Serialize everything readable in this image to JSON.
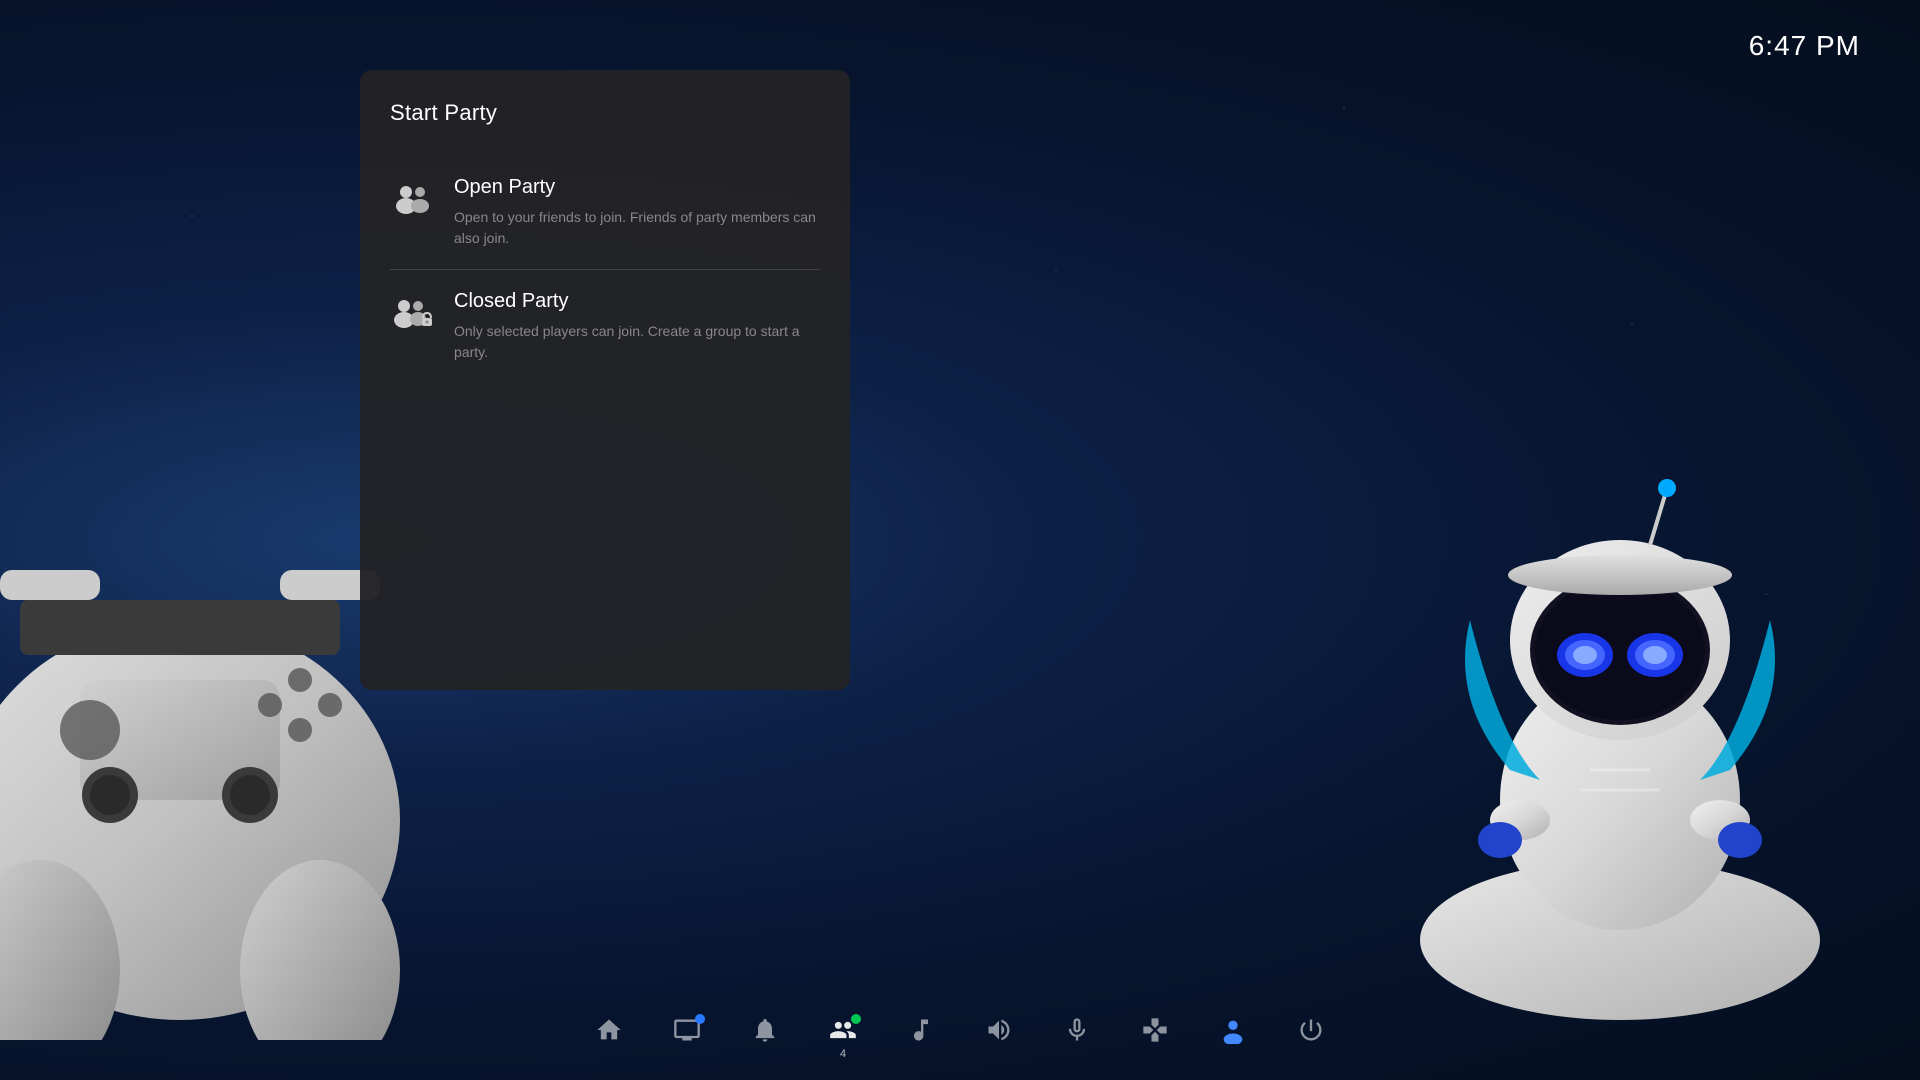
{
  "clock": {
    "time": "6:47 PM"
  },
  "panel": {
    "title": "Start Party",
    "items": [
      {
        "id": "open-party",
        "title": "Open Party",
        "description": "Open to your friends to join. Friends of party members can also join.",
        "icon": "open-party-icon"
      },
      {
        "id": "closed-party",
        "title": "Closed Party",
        "description": "Only selected players can join. Create a group to start a party.",
        "icon": "closed-party-icon"
      }
    ]
  },
  "taskbar": {
    "items": [
      {
        "id": "home",
        "icon": "home-icon",
        "label": "Home"
      },
      {
        "id": "store",
        "icon": "store-icon",
        "label": "Store"
      },
      {
        "id": "notifications",
        "icon": "bell-icon",
        "label": "Notifications",
        "dot": true
      },
      {
        "id": "party",
        "icon": "party-icon",
        "label": "Party",
        "badge": "4",
        "active": true
      },
      {
        "id": "music",
        "icon": "music-icon",
        "label": "Music"
      },
      {
        "id": "volume",
        "icon": "volume-icon",
        "label": "Volume"
      },
      {
        "id": "mic",
        "icon": "mic-icon",
        "label": "Microphone"
      },
      {
        "id": "controller",
        "icon": "controller-icon",
        "label": "Controller"
      },
      {
        "id": "profile",
        "icon": "profile-icon",
        "label": "Profile"
      },
      {
        "id": "power",
        "icon": "power-icon",
        "label": "Power"
      }
    ]
  }
}
